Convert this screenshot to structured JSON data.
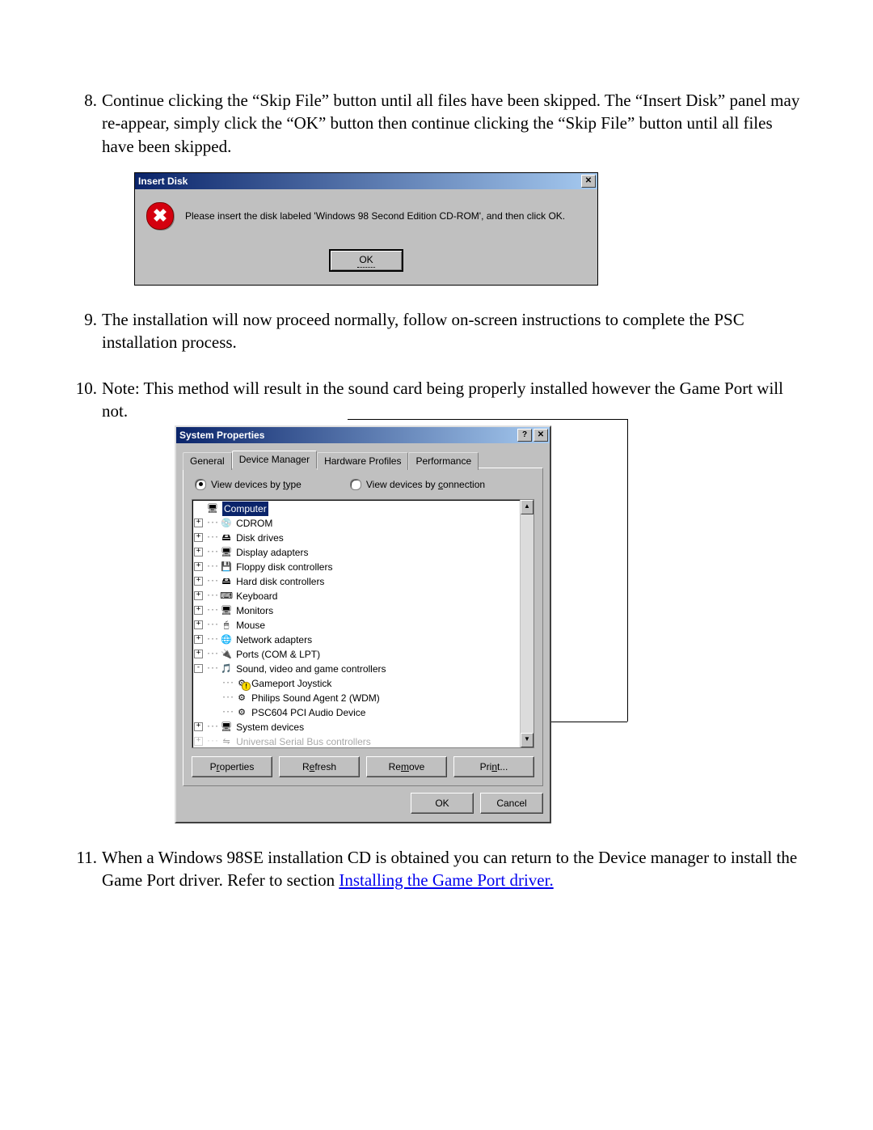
{
  "items": {
    "i8": {
      "num": "8.",
      "text": "Continue clicking the “Skip File” button until all files have been skipped. The “Insert Disk” panel may re-appear, simply click the “OK” button then continue clicking the “Skip File” button until all files have been skipped."
    },
    "i9": {
      "num": "9.",
      "text": "The installation will now proceed normally, follow on-screen instructions to complete the PSC installation process."
    },
    "i10": {
      "num": "10.",
      "text": "Note: This method will result in the sound card being properly installed however the Game Port will not."
    },
    "i11": {
      "num": "11.",
      "text_a": "When a Windows 98SE installation CD is obtained you can return to the Device manager to install the Game Port driver. Refer to section ",
      "link": "Installing the Game Port driver."
    }
  },
  "insertDisk": {
    "title": "Insert Disk",
    "message": "Please insert the disk labeled 'Windows 98 Second Edition CD-ROM', and then click OK.",
    "ok": "OK",
    "closeGlyph": "✕"
  },
  "sys": {
    "title": "System Properties",
    "help": "?",
    "close": "✕",
    "tabs": {
      "general": "General",
      "devmgr": "Device Manager",
      "hw": "Hardware Profiles",
      "perf": "Performance"
    },
    "radio_type_pre": "View devices by ",
    "radio_type_u": "t",
    "radio_type_post": "ype",
    "radio_conn_pre": "View devices by ",
    "radio_conn_u": "c",
    "radio_conn_post": "onnection",
    "tree": {
      "computer": "Computer",
      "cdrom": "CDROM",
      "disk": "Disk drives",
      "display": "Display adapters",
      "floppy": "Floppy disk controllers",
      "hdd": "Hard disk controllers",
      "kbd": "Keyboard",
      "mon": "Monitors",
      "mouse": "Mouse",
      "net": "Network adapters",
      "ports": "Ports (COM & LPT)",
      "sound": "Sound, video and game controllers",
      "gameport": "Gameport Joystick",
      "philips": "Philips Sound Agent 2 (WDM)",
      "psc604": "PSC604 PCI Audio Device",
      "sysdev": "System devices",
      "usb": "Universal Serial Bus controllers"
    },
    "icons": {
      "computer": "🖥",
      "cdrom": "💿",
      "disk": "🖴",
      "display": "🖥",
      "floppy": "💾",
      "hdd": "🖴",
      "kbd": "⌨",
      "mon": "🖥",
      "mouse": "🖱",
      "net": "🌐",
      "ports": "🔌",
      "sound": "🎵",
      "dev": "⚙",
      "sysdev": "🖥"
    },
    "buttons": {
      "properties_u": "r",
      "properties_pre": "P",
      "properties_post": "operties",
      "refresh_u": "e",
      "refresh_pre": "R",
      "refresh_post": "fresh",
      "remove_u": "m",
      "remove_pre": "Re",
      "remove_post": "ove",
      "print_u": "n",
      "print_pre": "Pri",
      "print_post": "t...",
      "ok": "OK",
      "cancel": "Cancel"
    },
    "scroll": {
      "up": "▲",
      "down": "▼"
    }
  }
}
